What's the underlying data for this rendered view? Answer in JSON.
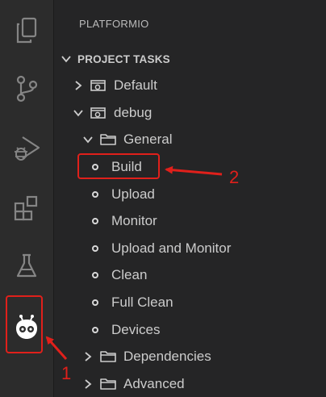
{
  "sidebar": {
    "title": "PLATFORMIO",
    "section": "PROJECT TASKS"
  },
  "tree": {
    "default_label": "Default",
    "debug_label": "debug",
    "general_label": "General",
    "tasks": [
      "Build",
      "Upload",
      "Monitor",
      "Upload and Monitor",
      "Clean",
      "Full Clean",
      "Devices"
    ],
    "dependencies_label": "Dependencies",
    "advanced_label": "Advanced"
  },
  "annotations": {
    "marker_1": "1",
    "marker_2": "2",
    "color": "#e0201b"
  },
  "activity_icons": [
    "explorer-icon",
    "source-control-icon",
    "run-debug-icon",
    "extensions-icon",
    "testing-icon",
    "platformio-icon"
  ]
}
